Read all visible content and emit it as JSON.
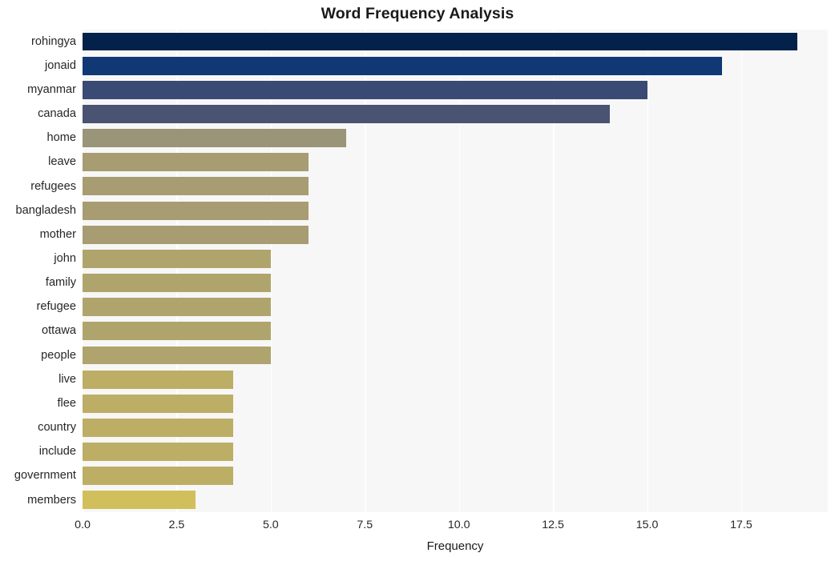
{
  "chart_data": {
    "type": "bar",
    "orientation": "horizontal",
    "title": "Word Frequency Analysis",
    "xlabel": "Frequency",
    "ylabel": "",
    "xlim": [
      0,
      19.8
    ],
    "ylim": [
      0,
      20
    ],
    "grid": true,
    "grid_color": "#ffffff",
    "plot_background": "#f7f7f7",
    "figure_background": "#ffffff",
    "legend": "none",
    "xticks": [
      "0.0",
      "2.5",
      "5.0",
      "7.5",
      "10.0",
      "12.5",
      "15.0",
      "17.5"
    ],
    "xtick_values": [
      0,
      2.5,
      5,
      7.5,
      10,
      12.5,
      15,
      17.5
    ],
    "categories": [
      "rohingya",
      "jonaid",
      "myanmar",
      "canada",
      "home",
      "leave",
      "refugees",
      "bangladesh",
      "mother",
      "john",
      "family",
      "refugee",
      "ottawa",
      "people",
      "live",
      "flee",
      "country",
      "include",
      "government",
      "members"
    ],
    "values": [
      19,
      17,
      15,
      14,
      7,
      6,
      6,
      6,
      6,
      5,
      5,
      5,
      5,
      5,
      4,
      4,
      4,
      4,
      4,
      3
    ],
    "bar_colors": [
      "#03214a",
      "#0f3875",
      "#394a74",
      "#4a5372",
      "#9a9478",
      "#a79c72",
      "#a89d72",
      "#a89d72",
      "#a89d72",
      "#b0a46d",
      "#b0a46d",
      "#b0a46d",
      "#b0a46d",
      "#afa36e",
      "#bdae66",
      "#bdae66",
      "#bdae66",
      "#bdae66",
      "#bdae66",
      "#d1bf5c"
    ]
  }
}
